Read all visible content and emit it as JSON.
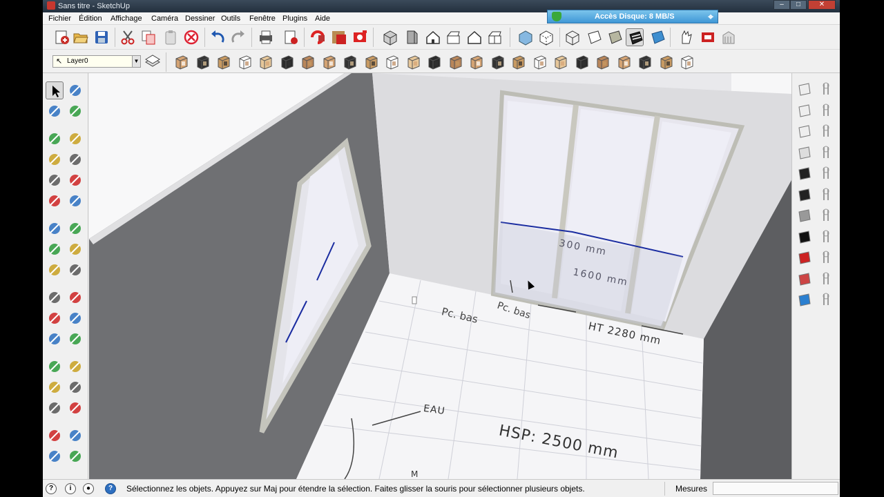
{
  "window": {
    "title": "Sans titre - SketchUp",
    "min": "–",
    "max": "□",
    "close": "✕"
  },
  "disk_widget": {
    "label": "Accès Disque: 8 MB/S",
    "pin": "⌖"
  },
  "menu": [
    "Fichier",
    "Édition",
    "Affichage",
    "Caméra",
    "Dessiner",
    "Outils",
    "Fenêtre",
    "Plugins",
    "Aide"
  ],
  "layer_select": {
    "value": "Layer0",
    "arrow": "▼",
    "cursor": "↖"
  },
  "toolbar_main_icons": [
    "new-model-icon",
    "open-icon",
    "save-icon",
    "cut-icon",
    "copy-icon",
    "paste-icon",
    "erase-icon",
    "undo-icon",
    "redo-icon",
    "print-icon",
    "model-info-icon",
    "component-options-icon",
    "material-icon",
    "scene-icon",
    "iso-view-icon",
    "top-view-icon",
    "front-view-icon",
    "right-view-icon",
    "back-view-icon",
    "left-view-icon",
    "xray-icon",
    "back-edges-icon",
    "wireframe-icon",
    "hidden-line-icon",
    "shaded-icon",
    "shaded-texture-icon",
    "monochrome-icon",
    "walk-icon",
    "extension-icon",
    "warehouse-icon"
  ],
  "toolbar_furniture_icons": [
    "furniture-1",
    "furniture-2",
    "furniture-3",
    "furniture-4",
    "furniture-5",
    "furniture-6",
    "furniture-7",
    "furniture-8",
    "furniture-9",
    "furniture-10",
    "furniture-11",
    "furniture-12",
    "furniture-13",
    "furniture-14",
    "furniture-15",
    "furniture-16",
    "furniture-17",
    "furniture-18",
    "furniture-19",
    "furniture-20",
    "furniture-21",
    "furniture-22",
    "furniture-23",
    "furniture-24",
    "furniture-25"
  ],
  "left_tools": [
    [
      "select-icon",
      "component-icon"
    ],
    [
      "paint-bucket-icon",
      "eraser-icon"
    ],
    [
      "rectangle-icon",
      "line-icon"
    ],
    [
      "circle-icon",
      "freehand-icon"
    ],
    [
      "polygon-icon",
      "arc-icon"
    ],
    [
      "pie-icon",
      "arc2-icon"
    ],
    [
      "move-icon",
      "push-pull-icon"
    ],
    [
      "rotate-icon",
      "follow-me-icon"
    ],
    [
      "scale-icon",
      "offset-icon"
    ],
    [
      "tape-measure-icon",
      "dimension-icon"
    ],
    [
      "protractor-icon",
      "text-icon"
    ],
    [
      "axes-icon",
      "3d-text-icon"
    ],
    [
      "orbit-icon",
      "pan-icon"
    ],
    [
      "zoom-icon",
      "zoom-window-icon"
    ],
    [
      "zoom-extents-icon",
      "previous-view-icon"
    ],
    [
      "position-camera-icon",
      "look-around-icon"
    ],
    [
      "walk-tool-icon",
      "section-plane-icon"
    ]
  ],
  "right_tools": [
    [
      "panel-1",
      "sandbox-1"
    ],
    [
      "panel-2",
      "sandbox-2"
    ],
    [
      "panel-3",
      "sandbox-3"
    ],
    [
      "panel-4",
      "sandbox-4"
    ],
    [
      "panel-5",
      "sandbox-5"
    ],
    [
      "panel-6",
      "sandbox-6"
    ],
    [
      "panel-7",
      "sandbox-7"
    ],
    [
      "panel-8",
      "sandbox-8"
    ],
    [
      "panel-9",
      "sandbox-9"
    ],
    [
      "panel-10",
      "sandbox-10"
    ],
    [
      "panel-11",
      "sandbox-11"
    ]
  ],
  "scene_annotations": {
    "dim_300": "300 mm",
    "dim_1600": "1600 mm",
    "pc_bas_1": "Pc. bas",
    "pc_bas_2": "Pc. bas",
    "ht": "HT 2280 mm",
    "eau": "EAU",
    "hsp": "HSP: 2500 mm",
    "bottom_mark": "M"
  },
  "status": {
    "message": "Sélectionnez les objets. Appuyez sur Maj pour étendre la sélection. Faites glisser la souris pour sélectionner plusieurs objets.",
    "measures_label": "Mesures",
    "measures_value": "",
    "icon_1": "?",
    "icon_2": "i",
    "icon_3": "●",
    "help": "?"
  },
  "colors": {
    "accent": "#2e6fc0",
    "wall": "#6b6c6f",
    "floor": "#f4f4f6",
    "edge": "#1a2ca0"
  }
}
